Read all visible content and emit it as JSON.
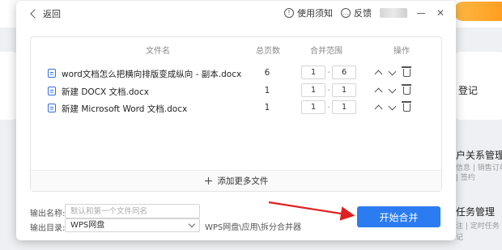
{
  "background": {
    "right_texts": [
      "登记",
      "户关系管理",
      "信息 | 销售订单",
      "| 签约",
      "任务管理",
      "注 | 定时任务",
      "记"
    ]
  },
  "dialog": {
    "back_label": "返回",
    "header": {
      "usage_notice": "使用须知",
      "feedback": "反馈",
      "minimize_icon": "minimize-icon",
      "close_icon": "close-icon"
    },
    "table": {
      "headers": {
        "file_name": "文件名",
        "total_pages": "总页数",
        "merge_range": "合并范围",
        "actions": "操作"
      },
      "rows": [
        {
          "name": "word文档怎么把横向排版变成纵向 - 副本.docx",
          "pages": "6",
          "range_start": "1",
          "range_end": "6"
        },
        {
          "name": "新建 DOCX 文档.docx",
          "pages": "1",
          "range_start": "1",
          "range_end": "1"
        },
        {
          "name": "新建 Microsoft Word 文档.docx",
          "pages": "1",
          "range_start": "1",
          "range_end": "1"
        }
      ],
      "add_more": "添加更多文件"
    },
    "output": {
      "name_label": "输出名称:",
      "name_placeholder": "默认和第一个文件同名",
      "dir_label": "输出目录:",
      "dir_value": "WPS网盘",
      "dir_path": "WPS网盘\\应用\\拆分合并器"
    },
    "start_button": "开始合并"
  },
  "colors": {
    "accent": "#2b7cf0",
    "annotation_arrow": "#e02020",
    "doc_icon": "#2f6fd6"
  }
}
